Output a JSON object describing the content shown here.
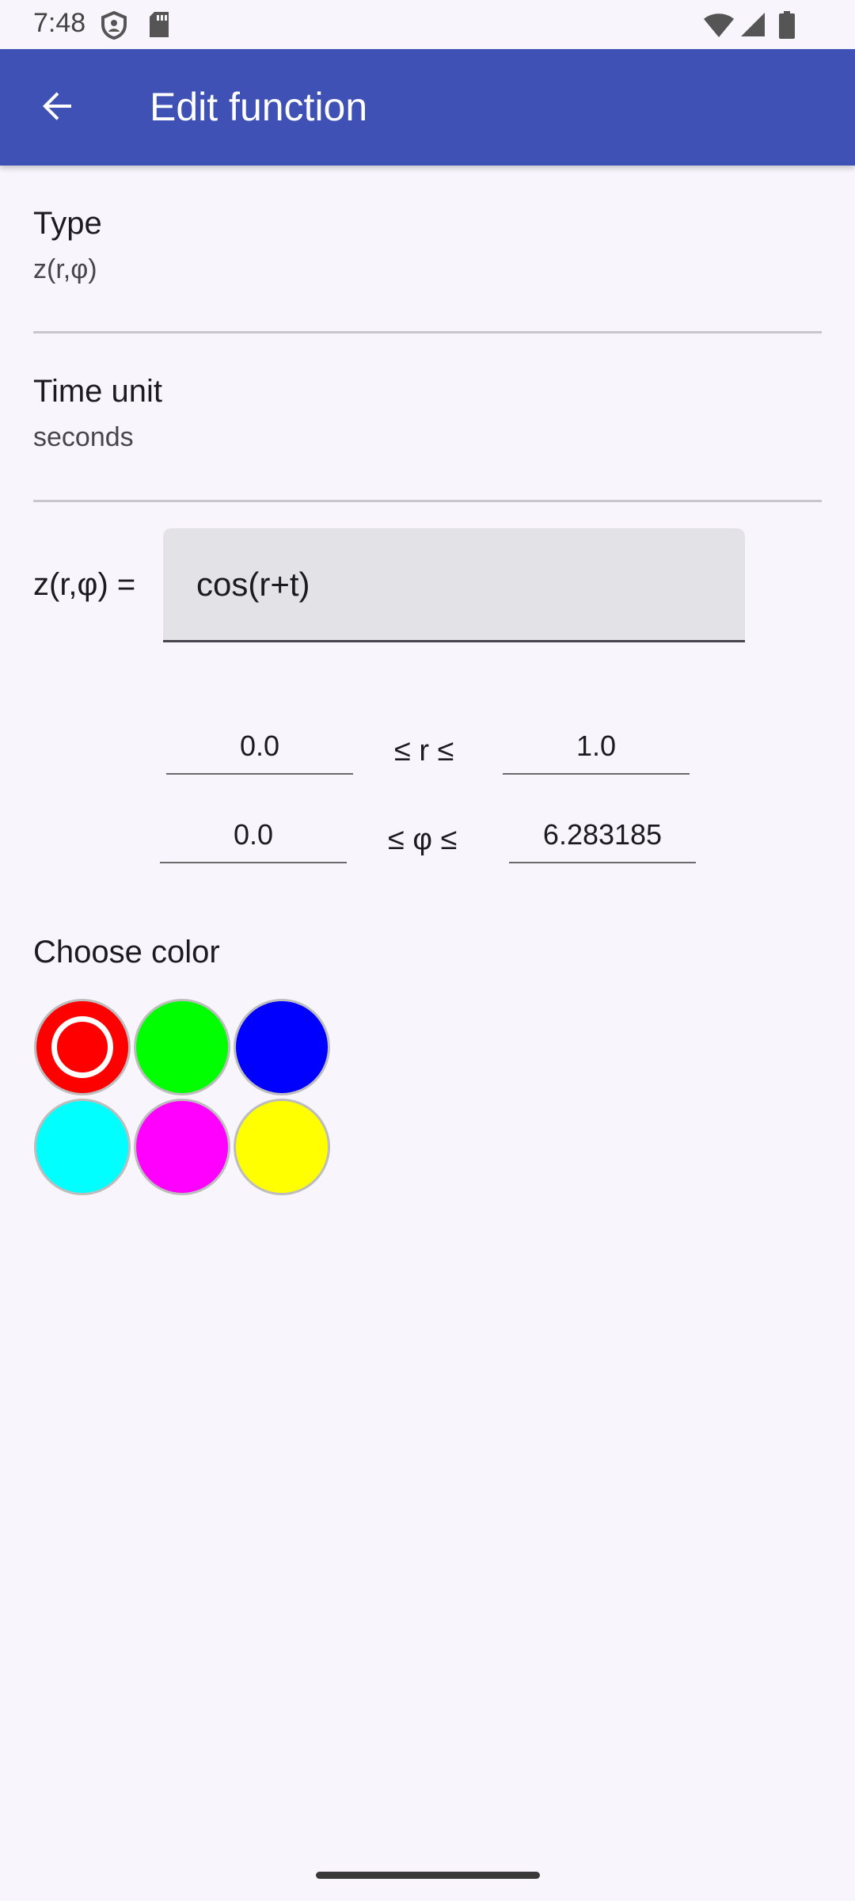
{
  "status_bar": {
    "time": "7:48"
  },
  "app_bar": {
    "title": "Edit function",
    "back_icon": "arrow-back-icon"
  },
  "type_pref": {
    "title": "Type",
    "value": "z(r,φ)"
  },
  "time_unit_pref": {
    "title": "Time unit",
    "value": "seconds"
  },
  "formula": {
    "label": "z(r,φ) =",
    "value": "cos(r+t)"
  },
  "ranges": {
    "r": {
      "min": "0.0",
      "operator": "≤ r ≤",
      "max": "1.0"
    },
    "phi": {
      "min": "0.0",
      "operator": "≤ φ ≤",
      "max": "6.283185"
    }
  },
  "color_picker": {
    "title": "Choose color",
    "selected": "red",
    "swatches": [
      {
        "name": "red",
        "hex": "#ff0000"
      },
      {
        "name": "green",
        "hex": "#00ff00"
      },
      {
        "name": "blue",
        "hex": "#0000ff"
      },
      {
        "name": "cyan",
        "hex": "#00ffff"
      },
      {
        "name": "magenta",
        "hex": "#ff00ff"
      },
      {
        "name": "yellow",
        "hex": "#ffff00"
      }
    ]
  },
  "colors": {
    "app_bar": "#3f51b5",
    "background": "#f8f6fc"
  }
}
